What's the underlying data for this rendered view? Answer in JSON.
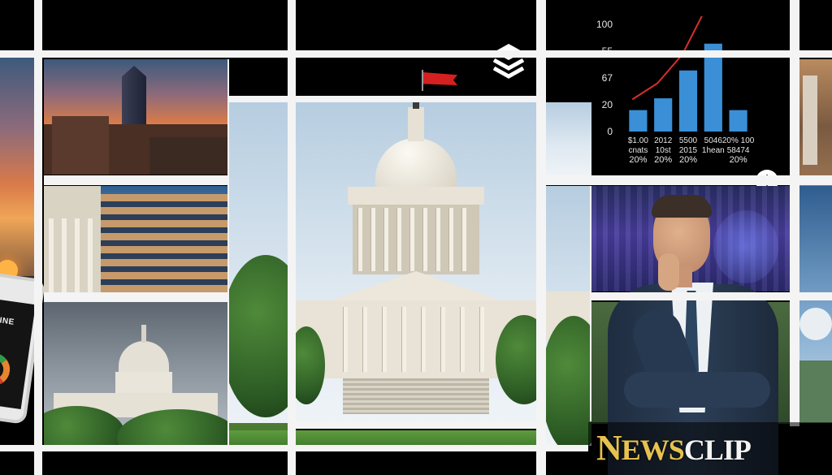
{
  "logo": {
    "text_big": "N",
    "text_mid": "EWS",
    "text_clip": "CLIP"
  },
  "phone": {
    "label": "VELINE"
  },
  "icons": {
    "dollar": "$",
    "dollar_name": "dollar-icon",
    "layers_name": "layers-icon",
    "flag_name": "flag-icon"
  },
  "colors": {
    "bar": "#3a8fd6",
    "trend_line": "#d6302b",
    "flag": "#d42020",
    "logo_gold": "#e7c24f"
  },
  "chart_data": {
    "type": "bar",
    "y_tick_labels": [
      "100",
      "55",
      "67",
      "20",
      "0"
    ],
    "categories": [
      "$1.00 cnats 20%",
      "2012 10st 20%",
      "5500 2015 20%",
      "5046 1hean",
      "20% 100 58474 20%"
    ],
    "category_lines": [
      [
        "$1.00",
        "cnats",
        "20%"
      ],
      [
        "2012",
        "10st",
        "20%"
      ],
      [
        "5500",
        "2015",
        "20%"
      ],
      [
        "5046",
        "1hean",
        ""
      ],
      [
        "20% 100",
        "58474",
        "20%"
      ]
    ],
    "values": [
      20,
      31,
      57,
      82,
      20
    ],
    "trend_line": [
      30,
      45,
      72,
      118
    ],
    "ylim": [
      0,
      100
    ],
    "grid": false
  }
}
